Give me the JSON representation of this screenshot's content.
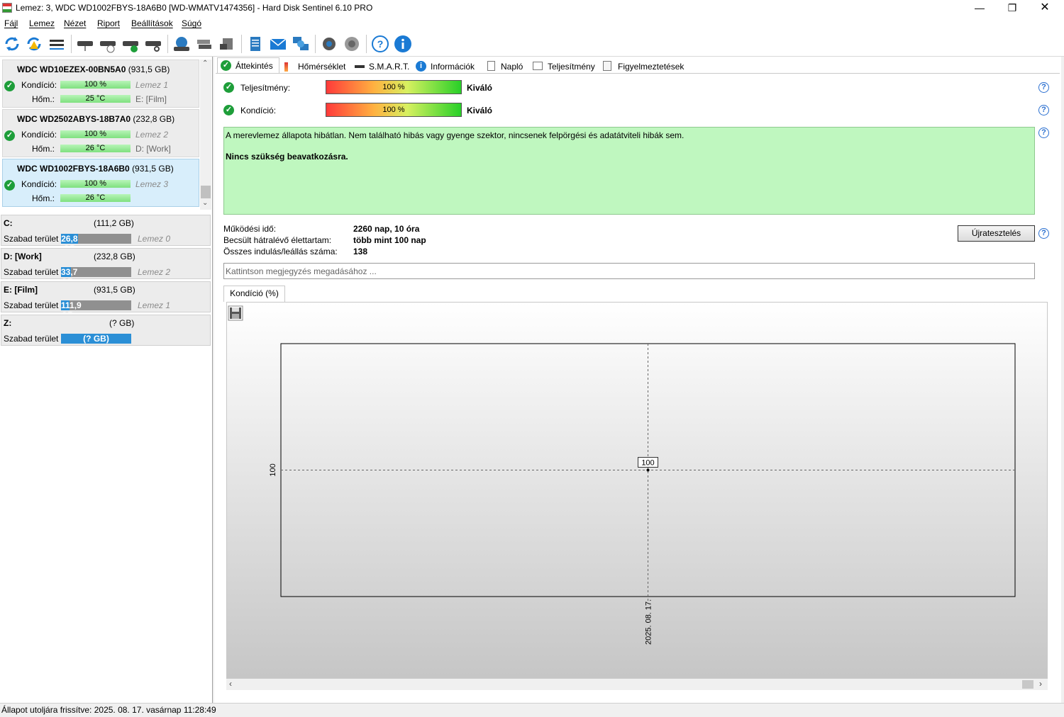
{
  "window": {
    "title": "Lemez: 3, WDC WD1002FBYS-18A6B0 [WD-WMATV1474356]  -  Hard Disk Sentinel 6.10 PRO"
  },
  "menu": [
    "Fájl",
    "Lemez",
    "Nézet",
    "Riport",
    "Beállítások",
    "Súgó"
  ],
  "disks": [
    {
      "name": "WDC WD10EZEX-00BN5A0",
      "size": "(931,5 GB)",
      "cond_label": "Kondíció:",
      "cond": "100 %",
      "cond_pct": 100,
      "disk_label": "Lemez 1",
      "temp_label": "Hőm.:",
      "temp": "25 °C",
      "part": "E: [Film]"
    },
    {
      "name": "WDC WD2502ABYS-18B7A0",
      "size": "(232,8 GB)",
      "cond_label": "Kondíció:",
      "cond": "100 %",
      "cond_pct": 100,
      "disk_label": "Lemez 2",
      "temp_label": "Hőm.:",
      "temp": "26 °C",
      "part": "D: [Work]"
    },
    {
      "name": "WDC WD1002FBYS-18A6B0",
      "size": "(931,5 GB)",
      "cond_label": "Kondíció:",
      "cond": "100 %",
      "cond_pct": 100,
      "disk_label": "Lemez 3",
      "temp_label": "Hőm.:",
      "temp": "26 °C",
      "part": ""
    }
  ],
  "volumes": [
    {
      "name": "C:",
      "size": "(111,2 GB)",
      "free_label": "Szabad terület",
      "free": "26,8 GB",
      "free_fraction": 0.24,
      "disk": "Lemez 0"
    },
    {
      "name": "D: [Work]",
      "size": "(232,8 GB)",
      "free_label": "Szabad terület",
      "free": "33,7 GB",
      "free_fraction": 0.14,
      "disk": "Lemez 2"
    },
    {
      "name": "E: [Film]",
      "size": "(931,5 GB)",
      "free_label": "Szabad terület",
      "free": "111,9 GB",
      "free_fraction": 0.12,
      "disk": "Lemez 1"
    },
    {
      "name": "Z:",
      "size": "(? GB)",
      "free_label": "Szabad terület",
      "free": "(? GB)",
      "free_fraction": 1.0,
      "disk": ""
    }
  ],
  "tabs": [
    "Áttekintés",
    "Hőmérséklet",
    "S.M.A.R.T.",
    "Információk",
    "Napló",
    "Teljesítmény",
    "Figyelmeztetések"
  ],
  "overview": {
    "perf_label": "Teljesítmény:",
    "perf_value": "100 %",
    "perf_status": "Kiváló",
    "cond_label": "Kondíció:",
    "cond_value": "100 %",
    "cond_status": "Kiváló",
    "message": "A merevlemez állapota hibátlan. Nem található hibás vagy gyenge szektor, nincsenek felpörgési és adatátviteli hibák sem.",
    "advice": "Nincs szükség beavatkozásra.",
    "uptime_label": "Működési idő:",
    "uptime": "2260 nap, 10 óra",
    "life_label": "Becsült hátralévő élettartam:",
    "life": "több mint 100 nap",
    "starts_label": "Összes indulás/leállás száma:",
    "starts": "138",
    "retest": "Újratesztelés",
    "note_placeholder": "Kattintson megjegyzés megadásához ..."
  },
  "chart_tab": "Kondíció  (%)",
  "chart_data": {
    "type": "line",
    "x": [
      "2025. 08. 17."
    ],
    "series": [
      {
        "values": [
          100
        ]
      }
    ],
    "ytick": "100",
    "point_label": "100"
  },
  "statusbar": "Állapot utoljára frissítve: 2025. 08. 17. vasárnap 11:28:49"
}
